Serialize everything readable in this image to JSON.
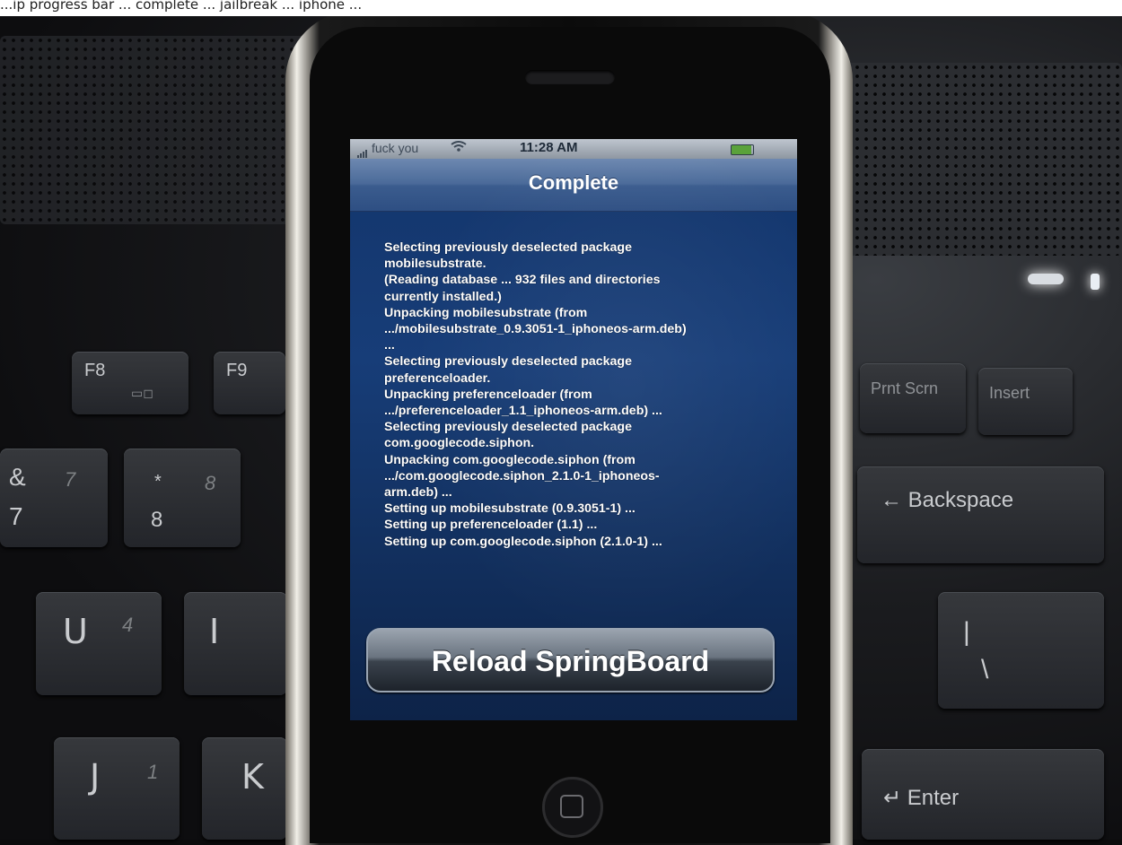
{
  "caption": "...ip progress bar ... complete ... jailbreak ... iphone ...",
  "keyboard": {
    "f8": "F8",
    "f8_sub": "▭◻",
    "f9": "F9",
    "amp": "&",
    "seven": "7",
    "seven_italic": "7",
    "star": "*",
    "eight": "8",
    "eight_italic": "8",
    "u": "U",
    "four_italic": "4",
    "i": "I",
    "j": "J",
    "one_italic": "1",
    "k": "K",
    "prtscn": "Prnt Scrn",
    "insert": "Insert",
    "backspace": "← Backspace",
    "pipe": "|",
    "backslash": "\\",
    "enter": "↵ Enter"
  },
  "status_bar": {
    "carrier": "fuck you",
    "signal_icon": "signal-bars-icon",
    "wifi_icon": "wifi-icon",
    "time": "11:28 AM",
    "battery_icon": "battery-icon",
    "battery_level": 0.92
  },
  "nav": {
    "title": "Complete"
  },
  "log": [
    "Selecting previously deselected package",
    "mobilesubstrate.",
    "(Reading database ... 932 files and directories",
    "currently installed.)",
    "Unpacking mobilesubstrate (from",
    ".../mobilesubstrate_0.9.3051-1_iphoneos-arm.deb)",
    "...",
    "Selecting previously deselected package",
    "preferenceloader.",
    "Unpacking preferenceloader (from",
    ".../preferenceloader_1.1_iphoneos-arm.deb) ...",
    "Selecting previously deselected package",
    "com.googlecode.siphon.",
    "Unpacking com.googlecode.siphon (from",
    ".../com.googlecode.siphon_2.1.0-1_iphoneos-",
    "arm.deb) ...",
    "Setting up mobilesubstrate (0.9.3051-1) ...",
    "Setting up preferenceloader (1.1) ...",
    "Setting up com.googlecode.siphon (2.1.0-1) ..."
  ],
  "reload_button": {
    "label": "Reload SpringBoard"
  }
}
